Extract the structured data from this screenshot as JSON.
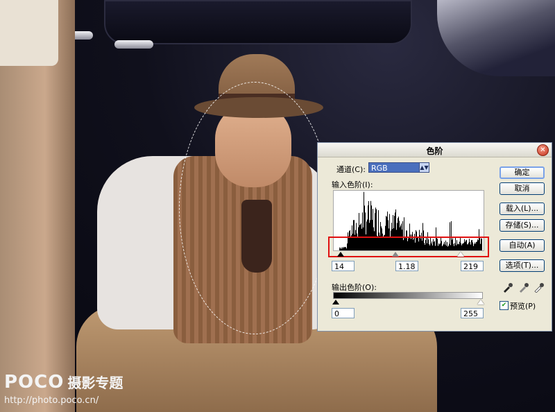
{
  "photo": {
    "watermark_logo": "POCO",
    "watermark_cn": "摄影专题",
    "watermark_url": "http://photo.poco.cn/"
  },
  "dialog": {
    "title": "色阶",
    "channel_label": "通道(C):",
    "channel_value": "RGB",
    "input_levels_label": "输入色阶(I):",
    "input_black": "14",
    "input_gamma": "1.18",
    "input_white": "219",
    "output_levels_label": "输出色阶(O):",
    "output_black": "0",
    "output_white": "255",
    "buttons": {
      "ok": "确定",
      "cancel": "取消",
      "load": "载入(L)...",
      "save": "存储(S)...",
      "auto": "自动(A)",
      "options": "选项(T)..."
    },
    "preview_label": "预览(P)",
    "preview_checked": true,
    "highlight_color": "#e01010"
  }
}
